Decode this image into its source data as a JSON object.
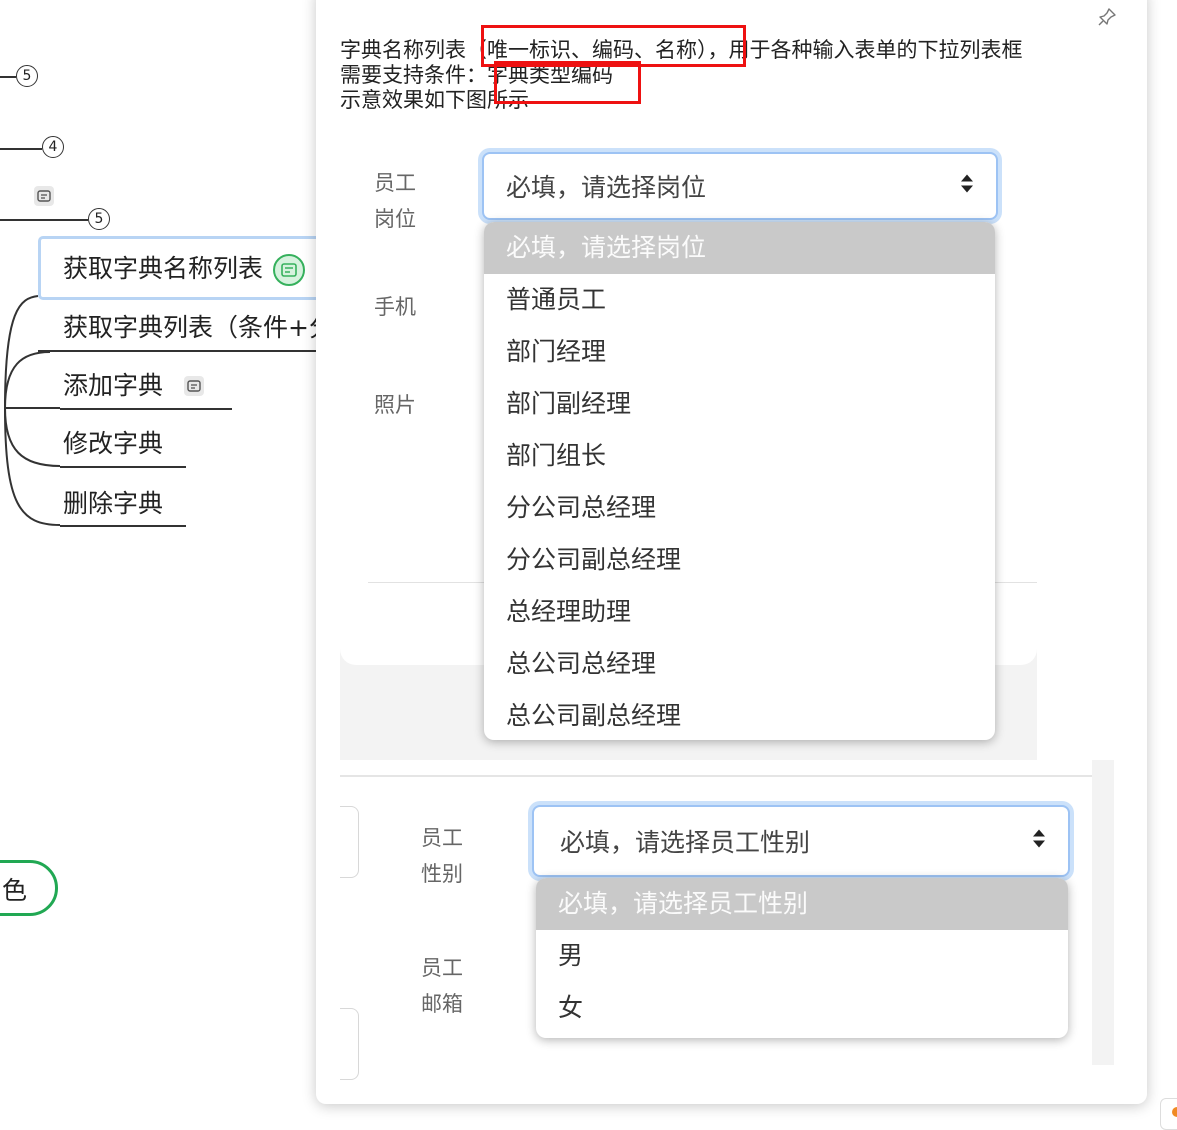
{
  "mindmap": {
    "counts": [
      "5",
      "4",
      "5"
    ],
    "nodes": [
      "获取字典名称列表",
      "获取字典列表（条件+分",
      "添加字典",
      "修改字典",
      "删除字典"
    ],
    "role_node": "角色"
  },
  "note": {
    "lines": [
      "字典名称列表（唯一标识、编码、名称），用于各种输入表单的下拉列表框",
      "需要支持条件：字典类型编码",
      "示意效果如下图所示"
    ],
    "form1": {
      "label_position_line1": "员工",
      "label_position_line2": "岗位",
      "label_phone": "手机",
      "label_photo": "照片",
      "select_value": "必填，请选择岗位",
      "options": [
        "必填，请选择岗位",
        "普通员工",
        "部门经理",
        "部门副经理",
        "部门组长",
        "分公司总经理",
        "分公司副总经理",
        "总经理助理",
        "总公司总经理",
        "总公司副总经理"
      ]
    },
    "form2": {
      "label_gender_line1": "员工",
      "label_gender_line2": "性别",
      "label_email_line1": "员工",
      "label_email_line2": "邮箱",
      "select_value": "必填，请选择员工性别",
      "options": [
        "必填，请选择员工性别",
        "男",
        "女"
      ]
    }
  },
  "colors": {
    "highlight": "#ee1111",
    "node_selected_border": "#b8d4f4",
    "role_border": "#21a853",
    "select_focus": "#9dc3f4"
  },
  "icons": {
    "pin": "pin-icon",
    "note": "note-icon",
    "sort": "sort-arrows-icon"
  }
}
